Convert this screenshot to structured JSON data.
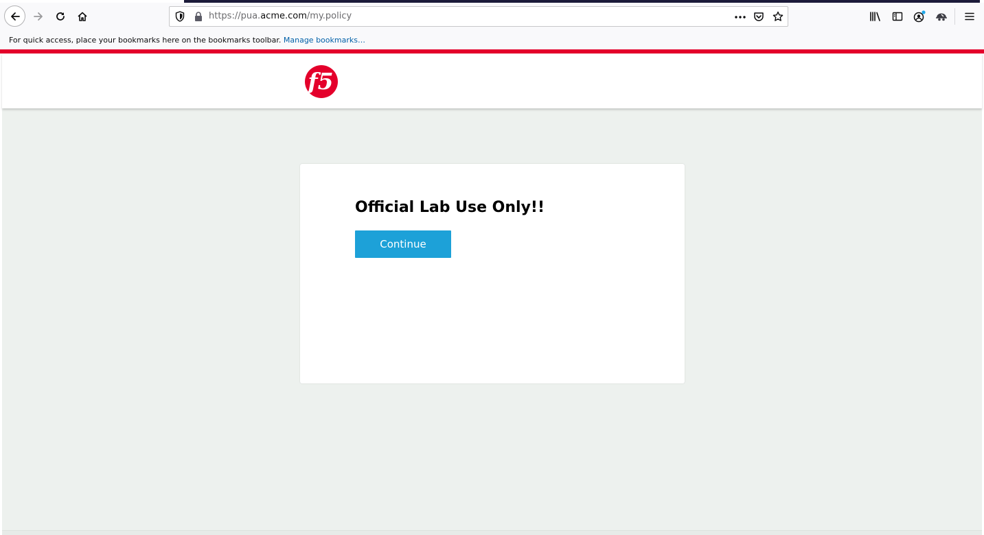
{
  "browser": {
    "url_prefix": "https://pua.",
    "url_domain": "acme.com",
    "url_path": "/my.policy",
    "icons": [
      "back-icon",
      "forward-icon",
      "reload-icon",
      "home-icon",
      "tracking-protection-icon",
      "lock-icon",
      "page-actions-icon",
      "pocket-icon",
      "bookmark-star-icon",
      "library-icon",
      "sidebar-icon",
      "account-icon",
      "extension-icon",
      "menu-icon"
    ]
  },
  "bookmarks_bar": {
    "message": "For quick access, place your bookmarks here on the bookmarks toolbar.",
    "manage_link": "Manage bookmarks…"
  },
  "header": {
    "logo_text": "f5",
    "brand_color": "#e4002b"
  },
  "card": {
    "title": "Official Lab Use Only!!",
    "continue_label": "Continue",
    "button_color": "#1da1d8"
  }
}
